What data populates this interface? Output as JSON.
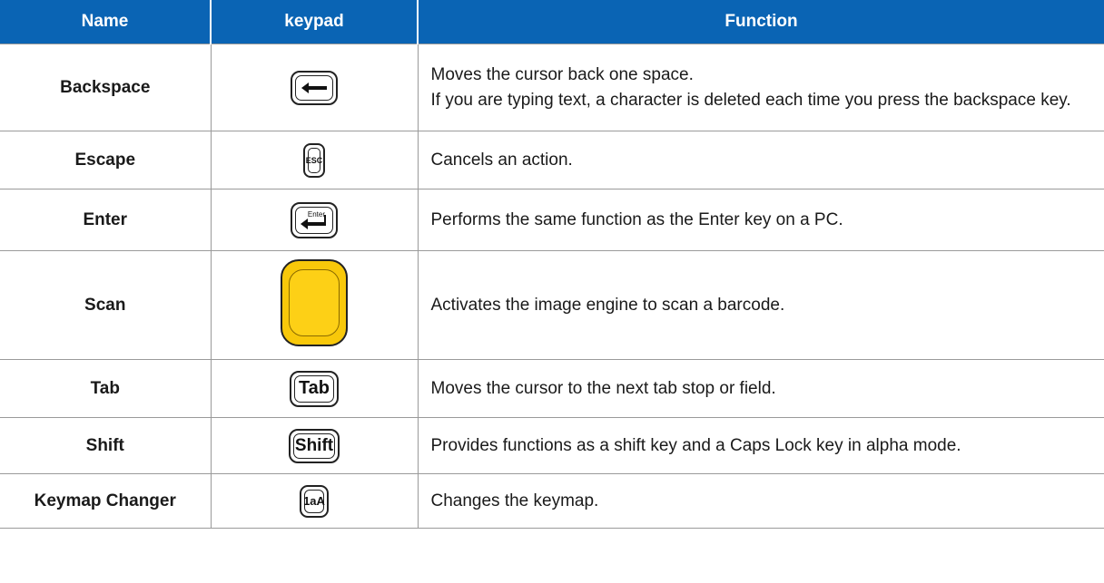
{
  "header": {
    "name": "Name",
    "keypad": "keypad",
    "function": "Function"
  },
  "rows": [
    {
      "name": "Backspace",
      "icon": "backspace-key-icon",
      "function_lines": [
        "Moves the cursor back one space.",
        "If you are typing text, a character is deleted each time you press the backspace key."
      ]
    },
    {
      "name": "Escape",
      "icon": "esc-key-icon",
      "key_label": "ESC",
      "function_lines": [
        "Cancels an action."
      ]
    },
    {
      "name": "Enter",
      "icon": "enter-key-icon",
      "key_label": "Enter",
      "function_lines": [
        "Performs the same function as the Enter key on a PC."
      ]
    },
    {
      "name": "Scan",
      "icon": "scan-key-icon",
      "function_lines": [
        "Activates the image engine to scan a barcode."
      ]
    },
    {
      "name": "Tab",
      "icon": "tab-key-icon",
      "key_label": "Tab",
      "function_lines": [
        "Moves the cursor to the next tab stop or field."
      ]
    },
    {
      "name": "Shift",
      "icon": "shift-key-icon",
      "key_label": "Shift",
      "function_lines": [
        "Provides functions as a shift key and a Caps Lock key in alpha mode."
      ]
    },
    {
      "name": "Keymap Changer",
      "icon": "keymap-changer-key-icon",
      "key_label": "1aA",
      "function_lines": [
        "Changes the keymap."
      ]
    }
  ],
  "colors": {
    "header_bg": "#0a64b4",
    "scan_key": "#f8c80a"
  }
}
